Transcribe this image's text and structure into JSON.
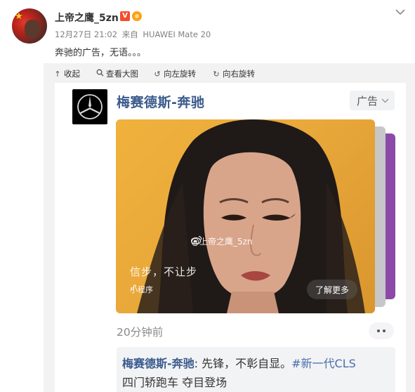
{
  "post": {
    "username": "上帝之鹰_5zn",
    "verified_badge": "V",
    "timestamp": "12月27日 21:02",
    "source_prefix": "来自",
    "device": "HUAWEI Mate 20",
    "text": "奔驰的广告，无语。。。"
  },
  "toolbar": {
    "collapse": "收起",
    "view_large": "查看大图",
    "rotate_left": "向左旋转",
    "rotate_right": "向右旋转"
  },
  "ad": {
    "advertiser": "梅赛德斯-奔驰",
    "ad_label": "广告",
    "watermark": "@上帝之鹰_5zn",
    "slogan": "信步，不让步",
    "mini_program": "小程序",
    "learn_more": "了解更多",
    "time_ago": "20分钟前",
    "quote_author": "梅赛德斯-奔驰",
    "quote_text": ": 先锋，不彰自显。",
    "quote_hashtag": "#新一代CLS",
    "quote_line2": "四门轿跑车 夺目登场"
  },
  "colors": {
    "link": "#3a5a8c",
    "toolbar_bg": "#f2f2f2",
    "hero_bg": "#e9a83a",
    "slide_purple": "#8c4aa8"
  }
}
